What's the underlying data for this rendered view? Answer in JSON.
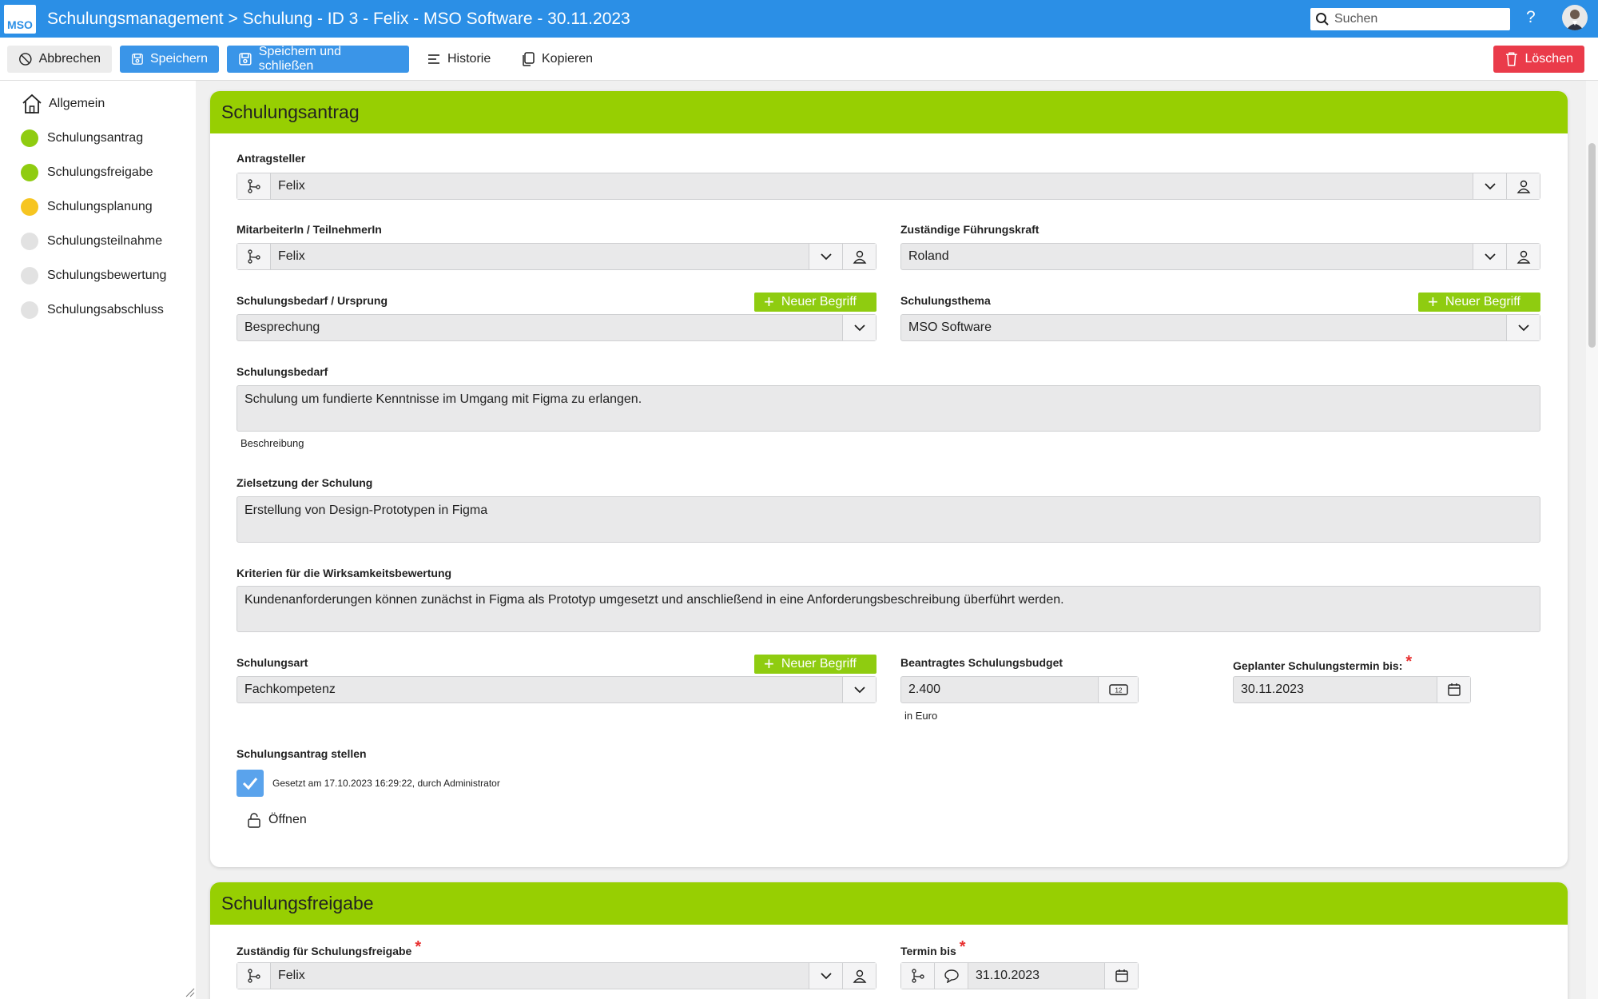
{
  "header": {
    "logo": "MSO",
    "title": "Schulungsmanagement > Schulung - ID 3 - Felix - MSO Software - 30.11.2023",
    "search_placeholder": "Suchen",
    "help": "?"
  },
  "toolbar": {
    "cancel": "Abbrechen",
    "save": "Speichern",
    "save_close": "Speichern und schließen",
    "history": "Historie",
    "copy": "Kopieren",
    "delete": "Löschen"
  },
  "sidebar": {
    "items": [
      {
        "label": "Allgemein",
        "status": "home"
      },
      {
        "label": "Schulungsantrag",
        "status": "done",
        "color": "#8fcc10"
      },
      {
        "label": "Schulungsfreigabe",
        "status": "done",
        "color": "#8fcc10"
      },
      {
        "label": "Schulungsplanung",
        "status": "active",
        "color": "#f6c521"
      },
      {
        "label": "Schulungsteilnahme",
        "status": "open",
        "color": "#e2e2e2"
      },
      {
        "label": "Schulungsbewertung",
        "status": "open",
        "color": "#e2e2e2"
      },
      {
        "label": "Schulungsabschluss",
        "status": "open",
        "color": "#e2e2e2"
      }
    ]
  },
  "antrag": {
    "header": "Schulungsantrag",
    "antragsteller_label": "Antragsteller",
    "antragsteller_value": "Felix",
    "mitarbeiter_label": "MitarbeiterIn / TeilnehmerIn",
    "mitarbeiter_value": "Felix",
    "fuehrungskraft_label": "Zuständige Führungskraft",
    "fuehrungskraft_value": "Roland",
    "bedarf_ursprung_label": "Schulungsbedarf / Ursprung",
    "bedarf_ursprung_value": "Besprechung",
    "thema_label": "Schulungsthema",
    "thema_value": "MSO Software",
    "new_term": "Neuer Begriff",
    "bedarf_label": "Schulungsbedarf",
    "bedarf_value": "Schulung um fundierte Kenntnisse im Umgang mit Figma zu erlangen.",
    "bedarf_hint": "Beschreibung",
    "ziel_label": "Zielsetzung der Schulung",
    "ziel_value": "Erstellung von Design-Prototypen in Figma",
    "kriterien_label": "Kriterien für die Wirksamkeitsbewertung",
    "kriterien_value": "Kundenanforderungen können zunächst in Figma als Prototyp umgesetzt und anschließend in eine Anforderungsbeschreibung überführt werden.",
    "art_label": "Schulungsart",
    "art_value": "Fachkompetenz",
    "budget_label": "Beantragtes Schulungsbudget",
    "budget_value": "2.400",
    "budget_hint": "in Euro",
    "termin_label": "Geplanter Schulungstermin bis:",
    "termin_value": "30.11.2023",
    "stellen_label": "Schulungsantrag stellen",
    "stellen_info": "Gesetzt am 17.10.2023 16:29:22, durch Administrator",
    "open_label": "Öffnen",
    "required_mark": "*"
  },
  "freigabe": {
    "header": "Schulungsfreigabe",
    "zustaendig_label": "Zuständig für Schulungsfreigabe",
    "zustaendig_value": "Felix",
    "termin_label": "Termin bis",
    "termin_value": "31.10.2023",
    "required_mark": "*"
  }
}
